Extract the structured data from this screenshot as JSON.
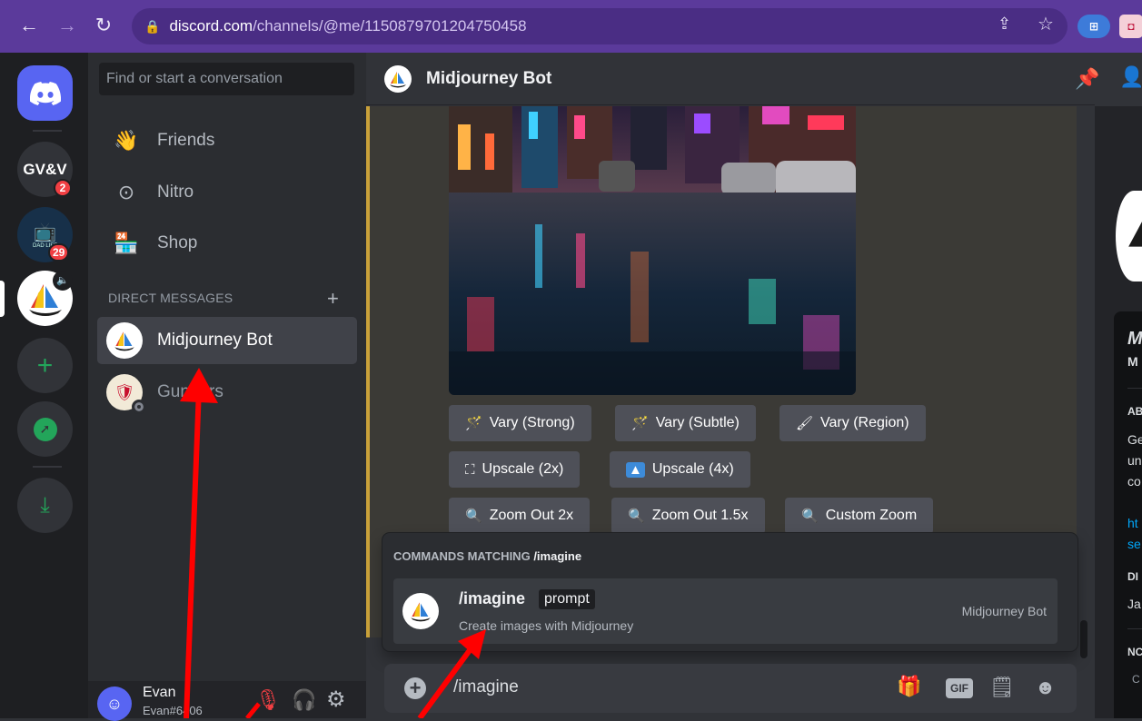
{
  "browser": {
    "url_host": "discord.com",
    "url_path": "/channels/@me/1150879701204750458"
  },
  "rail": {
    "servers": [
      {
        "label": "GV&V",
        "badge": "2"
      },
      {
        "label": "DAD LIFE",
        "badge": "29"
      }
    ]
  },
  "sidebar": {
    "search_placeholder": "Find or start a conversation",
    "nav": [
      {
        "label": "Friends"
      },
      {
        "label": "Nitro"
      },
      {
        "label": "Shop"
      }
    ],
    "dm_header": "DIRECT MESSAGES",
    "dms": [
      {
        "name": "Midjourney Bot"
      },
      {
        "name": "Gunners"
      }
    ],
    "user": {
      "name": "Evan",
      "tag": "Evan#6406"
    }
  },
  "header": {
    "title": "Midjourney Bot"
  },
  "buttons": {
    "row1": [
      "Vary (Strong)",
      "Vary (Subtle)",
      "Vary (Region)"
    ],
    "row2": [
      "Upscale (2x)",
      "Upscale (4x)"
    ],
    "row3": [
      "Zoom Out 2x",
      "Zoom Out 1.5x",
      "Custom Zoom"
    ]
  },
  "commands": {
    "heading": "COMMANDS MATCHING ",
    "query": "/imagine",
    "name": "/imagine",
    "param": "prompt",
    "desc": "Create images with Midjourney",
    "source": "Midjourney Bot"
  },
  "input": {
    "value": "/imagine"
  },
  "rightpanel": {
    "about_head": "AB",
    "about_lines": [
      "Ge",
      "un",
      "co"
    ],
    "link_lines": [
      "ht",
      "se"
    ],
    "sec2_head": "DI",
    "sec2_val": "Ja",
    "sec3_head": "NC",
    "sec3_val": "C",
    "title": "M",
    "subtitle": "M"
  },
  "colors": {
    "blurple": "#5865f2",
    "green": "#23a55a",
    "red_badge": "#f23f43",
    "embed_bar": "#c9a13a",
    "annotation_arrow": "#ff0000"
  }
}
